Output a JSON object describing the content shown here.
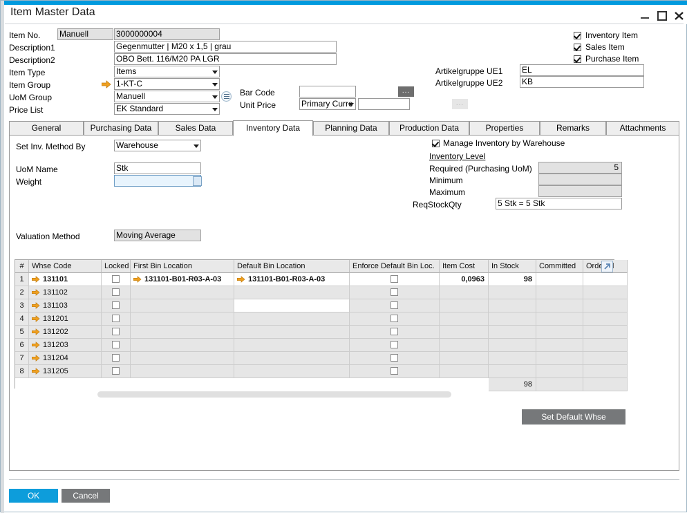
{
  "window": {
    "title": "Item Master Data",
    "controls": {
      "minimize": "minimize-icon",
      "maximize": "maximize-icon",
      "close": "close-icon"
    }
  },
  "header": {
    "labels": {
      "item_no": "Item No.",
      "description1": "Description1",
      "description2": "Description2",
      "item_type": "Item Type",
      "item_group": "Item Group",
      "uom_group": "UoM Group",
      "price_list": "Price List",
      "bar_code": "Bar Code",
      "unit_price": "Unit Price",
      "artikelgruppe_ue1": "Artikelgruppe UE1",
      "artikelgruppe_ue2": "Artikelgruppe UE2"
    },
    "values": {
      "item_no_mode": "Manuell",
      "item_no": "3000000004",
      "description1": "Gegenmutter | M20 x 1,5 | grau",
      "description2": "OBO Bett. 116/M20 PA LGR",
      "item_type": "Items",
      "item_group": "1-KT-C",
      "uom_group": "Manuell",
      "price_list": "EK Standard",
      "bar_code": "",
      "unit_price_currency": "Primary Curre",
      "unit_price": "",
      "artikelgruppe_ue1": "EL",
      "artikelgruppe_ue2": "KB"
    },
    "checkboxes": [
      {
        "label": "Inventory Item",
        "checked": true
      },
      {
        "label": "Sales Item",
        "checked": true
      },
      {
        "label": "Purchase Item",
        "checked": true
      }
    ],
    "ellipsis_label": "..."
  },
  "tabs": [
    {
      "label": "General",
      "active": false
    },
    {
      "label": "Purchasing Data",
      "active": false
    },
    {
      "label": "Sales Data",
      "active": false
    },
    {
      "label": "Inventory Data",
      "active": true
    },
    {
      "label": "Planning Data",
      "active": false
    },
    {
      "label": "Production Data",
      "active": false
    },
    {
      "label": "Properties",
      "active": false
    },
    {
      "label": "Remarks",
      "active": false
    },
    {
      "label": "Attachments",
      "active": false
    }
  ],
  "inventory": {
    "left": {
      "set_inv_method_by_label": "Set Inv. Method By",
      "set_inv_method_by": "Warehouse",
      "uom_name_label": "UoM Name",
      "uom_name": "Stk",
      "weight_label": "Weight",
      "weight": "",
      "valuation_method_label": "Valuation Method",
      "valuation_method": "Moving Average"
    },
    "right": {
      "manage_inventory_label": "Manage Inventory by Warehouse",
      "manage_inventory_checked": true,
      "inventory_level_label": "Inventory Level",
      "required_label": "Required (Purchasing UoM)",
      "required": "5",
      "minimum_label": "Minimum",
      "minimum": "",
      "maximum_label": "Maximum",
      "maximum": "",
      "reqstockqty_label": "ReqStockQty",
      "reqstockqty": "5  Stk = 5 Stk"
    }
  },
  "grid": {
    "columns": [
      "#",
      "Whse Code",
      "Locked",
      "First Bin Location",
      "Default Bin Location",
      "Enforce Default Bin Loc.",
      "Item Cost",
      "In Stock",
      "Committed",
      "Ordered"
    ],
    "rows": [
      {
        "idx": "1",
        "whse": "131101",
        "locked": false,
        "first_bin": "131101-B01-R03-A-03",
        "default_bin": "131101-B01-R03-A-03",
        "enforce": false,
        "item_cost": "0,0963",
        "in_stock": "98",
        "committed": "",
        "ordered": "",
        "selected": true
      },
      {
        "idx": "2",
        "whse": "131102",
        "locked": false,
        "first_bin": "",
        "default_bin": "",
        "enforce": false,
        "item_cost": "",
        "in_stock": "",
        "committed": "",
        "ordered": "",
        "selected": false
      },
      {
        "idx": "3",
        "whse": "131103",
        "locked": false,
        "first_bin": "",
        "default_bin": "",
        "enforce": false,
        "item_cost": "",
        "in_stock": "",
        "committed": "",
        "ordered": "",
        "selected": false,
        "default_bin_active": true
      },
      {
        "idx": "4",
        "whse": "131201",
        "locked": false,
        "first_bin": "",
        "default_bin": "",
        "enforce": false,
        "item_cost": "",
        "in_stock": "",
        "committed": "",
        "ordered": "",
        "selected": false
      },
      {
        "idx": "5",
        "whse": "131202",
        "locked": false,
        "first_bin": "",
        "default_bin": "",
        "enforce": false,
        "item_cost": "",
        "in_stock": "",
        "committed": "",
        "ordered": "",
        "selected": false
      },
      {
        "idx": "6",
        "whse": "131203",
        "locked": false,
        "first_bin": "",
        "default_bin": "",
        "enforce": false,
        "item_cost": "",
        "in_stock": "",
        "committed": "",
        "ordered": "",
        "selected": false
      },
      {
        "idx": "7",
        "whse": "131204",
        "locked": false,
        "first_bin": "",
        "default_bin": "",
        "enforce": false,
        "item_cost": "",
        "in_stock": "",
        "committed": "",
        "ordered": "",
        "selected": false
      },
      {
        "idx": "8",
        "whse": "131205",
        "locked": false,
        "first_bin": "",
        "default_bin": "",
        "enforce": false,
        "item_cost": "",
        "in_stock": "",
        "committed": "",
        "ordered": "",
        "selected": false
      }
    ],
    "totals": {
      "in_stock": "98"
    },
    "expand_icon": "expand-arrow-icon"
  },
  "actions": {
    "set_default_whse": "Set Default Whse",
    "ok": "OK",
    "cancel": "Cancel"
  }
}
